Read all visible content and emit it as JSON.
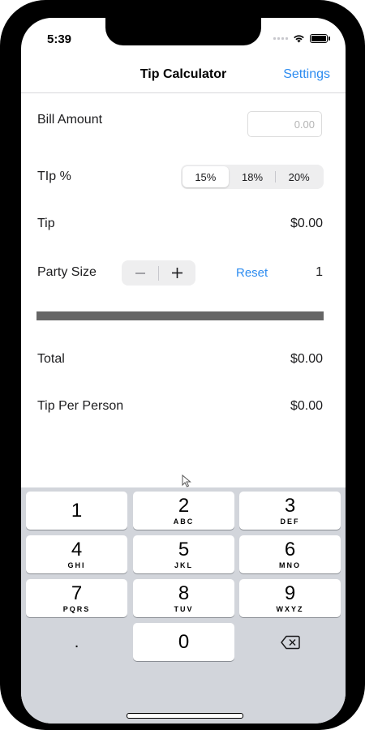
{
  "status": {
    "time": "5:39"
  },
  "nav": {
    "title": "Tip Calculator",
    "settings_label": "Settings"
  },
  "bill": {
    "label": "Bill Amount",
    "placeholder": "0.00"
  },
  "tip_percent": {
    "label": "TIp %",
    "options": [
      "15%",
      "18%",
      "20%"
    ],
    "selected_index": 0
  },
  "tip": {
    "label": "Tip",
    "value": "$0.00"
  },
  "party": {
    "label": "Party Size",
    "reset_label": "Reset",
    "value": "1"
  },
  "total": {
    "label": "Total",
    "value": "$0.00"
  },
  "per_person": {
    "label": "Tip Per Person",
    "value": "$0.00"
  },
  "keypad": {
    "keys": [
      {
        "num": "1",
        "letters": ""
      },
      {
        "num": "2",
        "letters": "ABC"
      },
      {
        "num": "3",
        "letters": "DEF"
      },
      {
        "num": "4",
        "letters": "GHI"
      },
      {
        "num": "5",
        "letters": "JKL"
      },
      {
        "num": "6",
        "letters": "MNO"
      },
      {
        "num": "7",
        "letters": "PQRS"
      },
      {
        "num": "8",
        "letters": "TUV"
      },
      {
        "num": "9",
        "letters": "WXYZ"
      },
      {
        "num": ".",
        "letters": ""
      },
      {
        "num": "0",
        "letters": ""
      }
    ]
  },
  "colors": {
    "accent": "#2d8cf0",
    "divider_bar": "#666666",
    "keyboard_bg": "#d2d5db"
  }
}
